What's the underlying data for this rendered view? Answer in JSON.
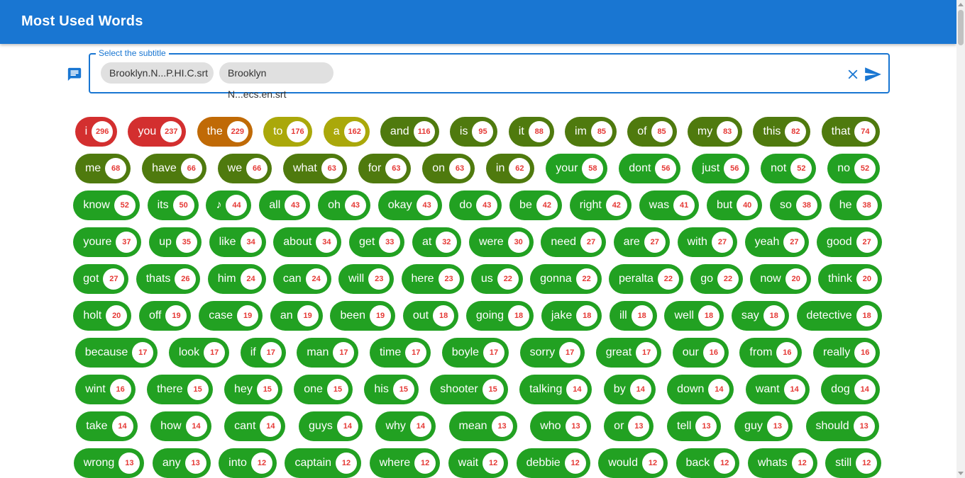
{
  "app": {
    "title": "Most Used Words"
  },
  "subtitle_field": {
    "label": "Select the subtitle",
    "chips": [
      "Brooklyn.N...P.HI.C.srt",
      "Brooklyn N...ecs.en.srt"
    ],
    "icons": {
      "field": "subtitles-icon",
      "clear": "close-icon",
      "send": "send-icon"
    }
  },
  "colors": {
    "appbar": "#1976d2",
    "red": "#d32f2f",
    "orange": "#c06a06",
    "yellow": "#aaa80a",
    "olive": "#4f7a0e",
    "green": "#22a122",
    "count_text": "#e53935"
  },
  "rows": [
    [
      [
        "i",
        296,
        "red"
      ],
      [
        "you",
        237,
        "red"
      ],
      [
        "the",
        229,
        "orange"
      ],
      [
        "to",
        176,
        "yellow"
      ],
      [
        "a",
        162,
        "yellow"
      ],
      [
        "and",
        116,
        "olive"
      ],
      [
        "is",
        95,
        "olive"
      ],
      [
        "it",
        88,
        "olive"
      ],
      [
        "im",
        85,
        "olive"
      ],
      [
        "of",
        85,
        "olive"
      ],
      [
        "my",
        83,
        "olive"
      ],
      [
        "this",
        82,
        "olive"
      ],
      [
        "that",
        74,
        "olive"
      ]
    ],
    [
      [
        "me",
        68,
        "olive"
      ],
      [
        "have",
        66,
        "olive"
      ],
      [
        "we",
        66,
        "olive"
      ],
      [
        "what",
        63,
        "olive"
      ],
      [
        "for",
        63,
        "olive"
      ],
      [
        "on",
        63,
        "olive"
      ],
      [
        "in",
        62,
        "olive"
      ],
      [
        "your",
        58,
        "green"
      ],
      [
        "dont",
        56,
        "green"
      ],
      [
        "just",
        56,
        "green"
      ],
      [
        "not",
        52,
        "green"
      ],
      [
        "no",
        52,
        "green"
      ]
    ],
    [
      [
        "know",
        52,
        "green"
      ],
      [
        "its",
        50,
        "green"
      ],
      [
        "♪",
        44,
        "green"
      ],
      [
        "all",
        43,
        "green"
      ],
      [
        "oh",
        43,
        "green"
      ],
      [
        "okay",
        43,
        "green"
      ],
      [
        "do",
        43,
        "green"
      ],
      [
        "be",
        42,
        "green"
      ],
      [
        "right",
        42,
        "green"
      ],
      [
        "was",
        41,
        "green"
      ],
      [
        "but",
        40,
        "green"
      ],
      [
        "so",
        38,
        "green"
      ],
      [
        "he",
        38,
        "green"
      ]
    ],
    [
      [
        "youre",
        37,
        "green"
      ],
      [
        "up",
        35,
        "green"
      ],
      [
        "like",
        34,
        "green"
      ],
      [
        "about",
        34,
        "green"
      ],
      [
        "get",
        33,
        "green"
      ],
      [
        "at",
        32,
        "green"
      ],
      [
        "were",
        30,
        "green"
      ],
      [
        "need",
        27,
        "green"
      ],
      [
        "are",
        27,
        "green"
      ],
      [
        "with",
        27,
        "green"
      ],
      [
        "yeah",
        27,
        "green"
      ],
      [
        "good",
        27,
        "green"
      ]
    ],
    [
      [
        "got",
        27,
        "green"
      ],
      [
        "thats",
        26,
        "green"
      ],
      [
        "him",
        24,
        "green"
      ],
      [
        "can",
        24,
        "green"
      ],
      [
        "will",
        23,
        "green"
      ],
      [
        "here",
        23,
        "green"
      ],
      [
        "us",
        22,
        "green"
      ],
      [
        "gonna",
        22,
        "green"
      ],
      [
        "peralta",
        22,
        "green"
      ],
      [
        "go",
        22,
        "green"
      ],
      [
        "now",
        20,
        "green"
      ],
      [
        "think",
        20,
        "green"
      ]
    ],
    [
      [
        "holt",
        20,
        "green"
      ],
      [
        "off",
        19,
        "green"
      ],
      [
        "case",
        19,
        "green"
      ],
      [
        "an",
        19,
        "green"
      ],
      [
        "been",
        19,
        "green"
      ],
      [
        "out",
        18,
        "green"
      ],
      [
        "going",
        18,
        "green"
      ],
      [
        "jake",
        18,
        "green"
      ],
      [
        "ill",
        18,
        "green"
      ],
      [
        "well",
        18,
        "green"
      ],
      [
        "say",
        18,
        "green"
      ],
      [
        "detective",
        18,
        "green"
      ]
    ],
    [
      [
        "because",
        17,
        "green"
      ],
      [
        "look",
        17,
        "green"
      ],
      [
        "if",
        17,
        "green"
      ],
      [
        "man",
        17,
        "green"
      ],
      [
        "time",
        17,
        "green"
      ],
      [
        "boyle",
        17,
        "green"
      ],
      [
        "sorry",
        17,
        "green"
      ],
      [
        "great",
        17,
        "green"
      ],
      [
        "our",
        16,
        "green"
      ],
      [
        "from",
        16,
        "green"
      ],
      [
        "really",
        16,
        "green"
      ]
    ],
    [
      [
        "wint",
        16,
        "green"
      ],
      [
        "there",
        15,
        "green"
      ],
      [
        "hey",
        15,
        "green"
      ],
      [
        "one",
        15,
        "green"
      ],
      [
        "his",
        15,
        "green"
      ],
      [
        "shooter",
        15,
        "green"
      ],
      [
        "talking",
        14,
        "green"
      ],
      [
        "by",
        14,
        "green"
      ],
      [
        "down",
        14,
        "green"
      ],
      [
        "want",
        14,
        "green"
      ],
      [
        "dog",
        14,
        "green"
      ]
    ],
    [
      [
        "take",
        14,
        "green"
      ],
      [
        "how",
        14,
        "green"
      ],
      [
        "cant",
        14,
        "green"
      ],
      [
        "guys",
        14,
        "green"
      ],
      [
        "why",
        14,
        "green"
      ],
      [
        "mean",
        13,
        "green"
      ],
      [
        "who",
        13,
        "green"
      ],
      [
        "or",
        13,
        "green"
      ],
      [
        "tell",
        13,
        "green"
      ],
      [
        "guy",
        13,
        "green"
      ],
      [
        "should",
        13,
        "green"
      ]
    ],
    [
      [
        "wrong",
        13,
        "green"
      ],
      [
        "any",
        13,
        "green"
      ],
      [
        "into",
        12,
        "green"
      ],
      [
        "captain",
        12,
        "green"
      ],
      [
        "where",
        12,
        "green"
      ],
      [
        "wait",
        12,
        "green"
      ],
      [
        "debbie",
        12,
        "green"
      ],
      [
        "would",
        12,
        "green"
      ],
      [
        "back",
        12,
        "green"
      ],
      [
        "whats",
        12,
        "green"
      ],
      [
        "still",
        12,
        "green"
      ]
    ]
  ]
}
